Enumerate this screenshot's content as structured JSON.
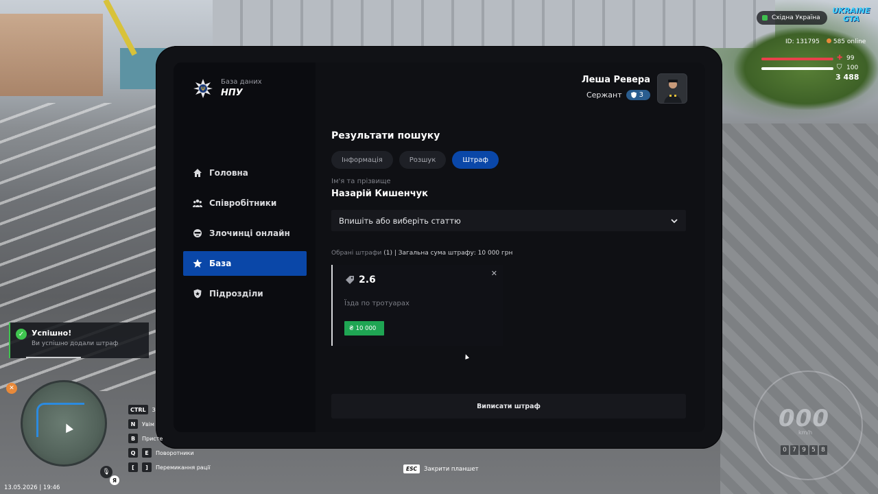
{
  "hud": {
    "region": "Східна Україна",
    "logo_line1": "UKRAINE",
    "logo_line2": "GTA",
    "player_id": "ID: 131795",
    "online": "585 online",
    "health": "99",
    "armor": "100",
    "money": "3 488",
    "health_fraction": 0.99,
    "armor_fraction": 1.0,
    "health_color": "#e8414b",
    "armor_color": "#ffffff",
    "datetime": "13.05.2026 | 19:46",
    "lang": "Я",
    "esc_key": "ESC",
    "esc_label": "Закрити планшет",
    "speed": "000",
    "speed_unit": "km/h",
    "odometer": [
      "0",
      "7",
      "9",
      "5",
      "8"
    ],
    "keybinds": [
      {
        "keys": [
          "CTRL"
        ],
        "label": "З"
      },
      {
        "keys": [
          "N"
        ],
        "label": "Увім"
      },
      {
        "keys": [
          "B"
        ],
        "label": "Присте"
      },
      {
        "keys": [
          "Q",
          "E"
        ],
        "label": "Поворотники"
      },
      {
        "keys": [
          "[",
          "]"
        ],
        "label": "Перемикання рації"
      }
    ]
  },
  "toast": {
    "title": "Успішно!",
    "text": "Ви успішно додали штраф",
    "accent": "#3fc54f"
  },
  "tablet": {
    "app_subtitle": "База даних",
    "app_title": "НПУ",
    "user": {
      "name": "Леша Ревера",
      "rank": "Сержант",
      "rank_level": "3"
    },
    "nav": [
      {
        "label": "Головна",
        "icon": "home-icon",
        "active": false
      },
      {
        "label": "Співробітники",
        "icon": "users-icon",
        "active": false
      },
      {
        "label": "Злочинці онлайн",
        "icon": "criminal-icon",
        "active": false
      },
      {
        "label": "База",
        "icon": "star-icon",
        "active": true
      },
      {
        "label": "Підрозділи",
        "icon": "shield-icon",
        "active": false
      }
    ],
    "results_title": "Результати пошуку",
    "tabs": [
      {
        "label": "Інформація",
        "active": false
      },
      {
        "label": "Розшук",
        "active": false
      },
      {
        "label": "Штраф",
        "active": true
      }
    ],
    "name_label": "Ім'я та прізвище",
    "person_name": "Назарій Кишенчук",
    "article_select_placeholder": "Впишіть або виберіть статтю",
    "summary_muted": "Обрані штрафи",
    "summary_count": "(1)",
    "summary_rest": "| Загальна сума штрафу: 10 000 грн",
    "fine": {
      "code": "2.6",
      "description": "Їзда по тротуарах",
      "amount": "10 000",
      "currency_symbol": "₴"
    },
    "issue_button": "Виписати штраф",
    "accent": "#0a47a8",
    "success": "#1fa553"
  }
}
